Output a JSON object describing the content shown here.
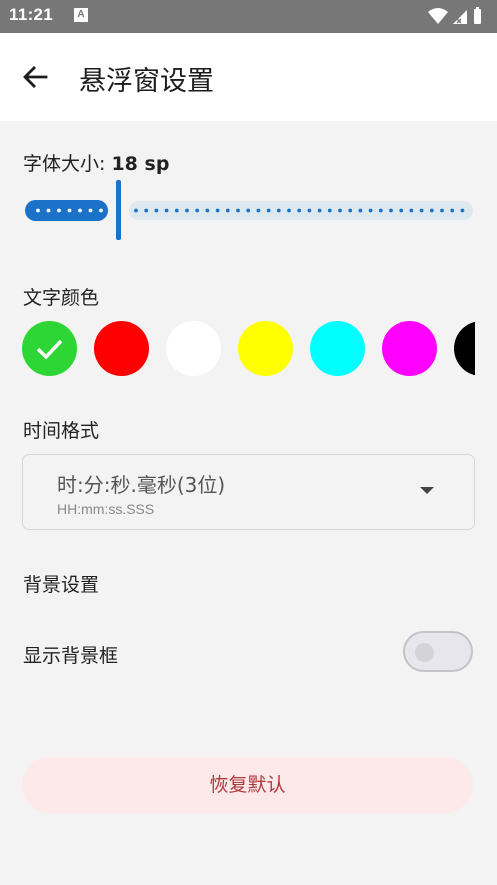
{
  "status_bar": {
    "time": "11:21",
    "notification_icon": "A"
  },
  "app_bar": {
    "title": "悬浮窗设置"
  },
  "font_size": {
    "label": "字体大小: ",
    "value": "18 sp",
    "level": 0.21
  },
  "text_color": {
    "label": "文字颜色",
    "selected_index": 0,
    "options": [
      "#2ed635",
      "#ff0000",
      "#ffffff",
      "#ffff00",
      "#00ffff",
      "#ff00ff",
      "#000000"
    ]
  },
  "time_format": {
    "label": "时间格式",
    "selected_label": "时:分:秒.毫秒(3位)",
    "selected_pattern": "HH:mm:ss.SSS"
  },
  "background": {
    "section_label": "背景设置",
    "show_frame_label": "显示背景框",
    "show_frame_on": false
  },
  "reset_button": {
    "label": "恢复默认"
  },
  "colors": {
    "accent": "#1a73c8",
    "status_bar": "#777777",
    "reset_text": "#b03a3c",
    "reset_bg": "#fde9ea"
  }
}
